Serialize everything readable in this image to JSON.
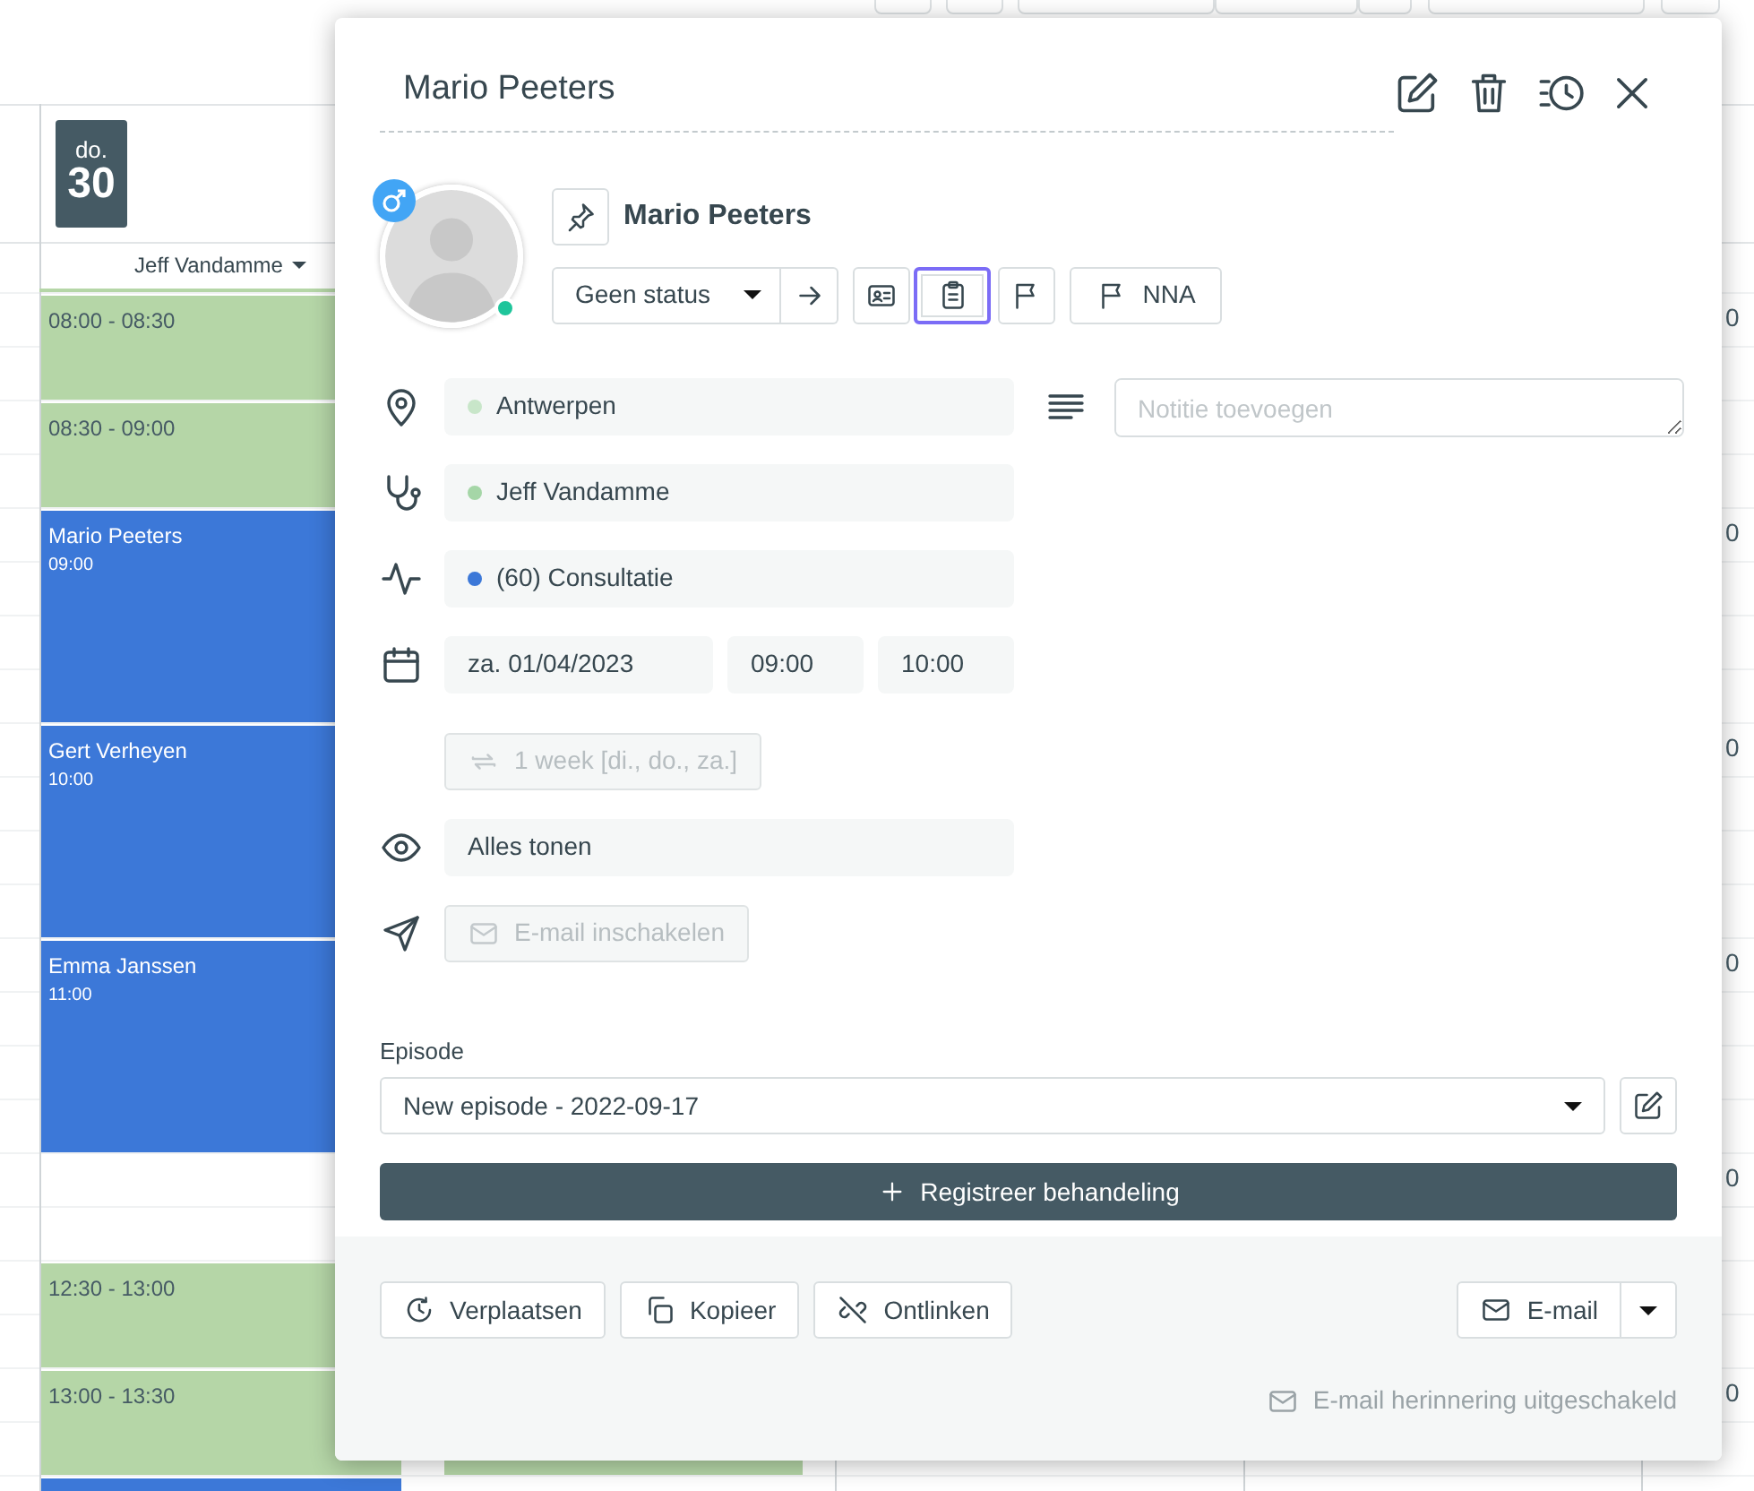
{
  "calendar": {
    "day": {
      "weekday": "do.",
      "date": "30"
    },
    "resource": {
      "name": "Jeff Vandamme"
    },
    "events": [
      {
        "kind": "free",
        "time": "08:00 - 08:30"
      },
      {
        "kind": "free",
        "time": "08:30 - 09:00"
      },
      {
        "kind": "appointment",
        "patient": "Mario Peeters",
        "time": "09:00"
      },
      {
        "kind": "appointment",
        "patient": "Gert Verheyen",
        "time": "10:00"
      },
      {
        "kind": "appointment",
        "patient": "Emma Janssen",
        "time": "11:00"
      },
      {
        "kind": "empty"
      },
      {
        "kind": "free",
        "time": "12:30 - 13:00"
      },
      {
        "kind": "free",
        "time": "13:00 - 13:30"
      },
      {
        "kind": "appointment"
      }
    ],
    "column_2_events": [
      {
        "kind": "empty"
      },
      {
        "kind": "empty"
      },
      {
        "kind": "empty"
      },
      {
        "kind": "empty"
      },
      {
        "kind": "empty"
      },
      {
        "kind": "empty"
      },
      {
        "kind": "empty"
      },
      {
        "kind": "empty"
      },
      {
        "kind": "empty"
      },
      {
        "kind": "empty"
      },
      {
        "kind": "free"
      }
    ],
    "edge_fragments": [
      "0",
      "0",
      "0",
      "0",
      "0",
      "0"
    ]
  },
  "popup": {
    "title": "Mario Peeters",
    "patient": {
      "name": "Mario Peeters",
      "online": true,
      "status": "Geen status",
      "action_buttons": [
        {
          "focused": false
        },
        {
          "focused": true
        },
        {
          "focused": false
        }
      ],
      "flag_button": "NNA"
    },
    "location": {
      "value": "Antwerpen",
      "color": "#c8e6c9"
    },
    "practitioner": {
      "value": "Jeff Vandamme",
      "color": "#a5d6a7"
    },
    "activity": {
      "value": "(60) Consultatie",
      "color": "#3c78d8"
    },
    "date": "za. 01/04/2023",
    "start_time": "09:00",
    "end_time": "10:00",
    "recurrence": {
      "label": "1 week [di., do., za.]",
      "disabled": true
    },
    "visibility": "Alles tonen",
    "email_toggle": {
      "label": "E-mail inschakelen",
      "disabled": true
    },
    "note": {
      "placeholder": "Notitie toevoegen"
    },
    "episode": {
      "label": "Episode",
      "value": "New episode - 2022-09-17"
    },
    "register_button": "Registreer behandeling",
    "footer_buttons": [
      "Verplaatsen",
      "Kopieer",
      "Ontlinken"
    ],
    "email_button": "E-mail",
    "reminder": "E-mail herinnering uitgeschakeld"
  }
}
